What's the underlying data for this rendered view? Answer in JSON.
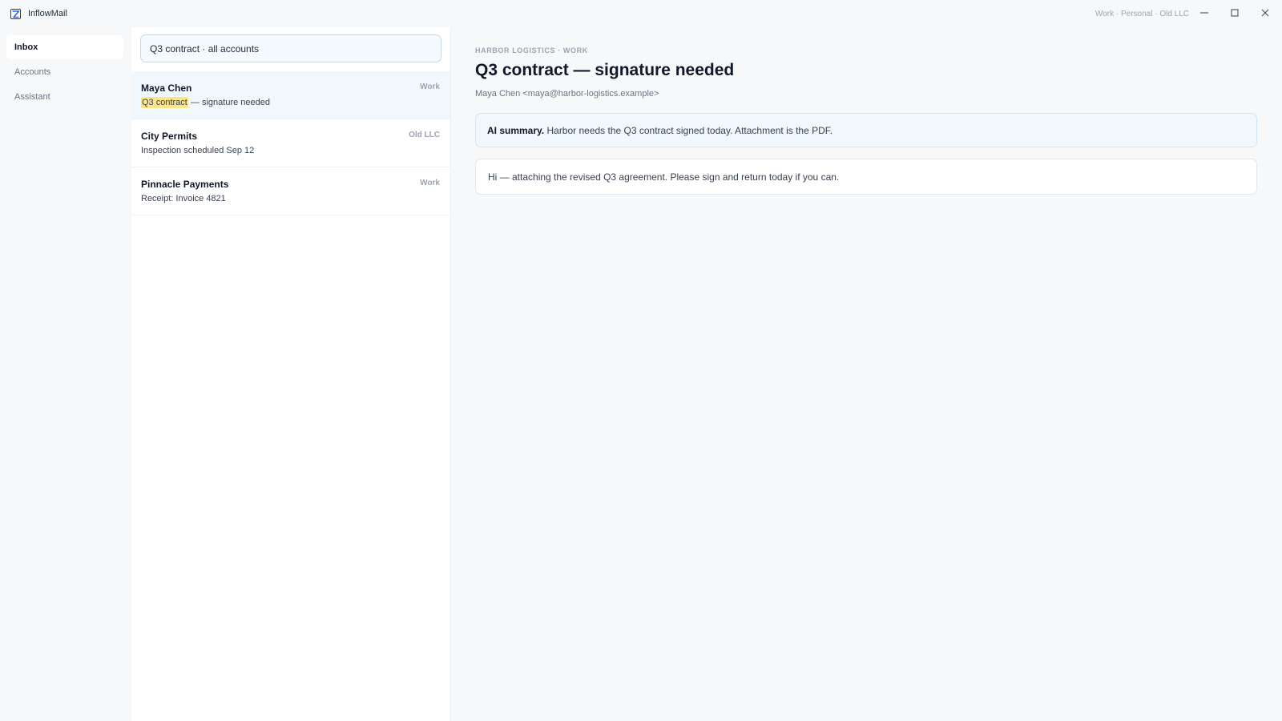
{
  "app": {
    "title": "InflowMail",
    "accounts_caption": "Work · Personal · Old LLC",
    "logo_icon": "inflowmail-logo-icon",
    "accent_color": "#2563eb"
  },
  "window_controls": {
    "minimize_icon": "minimize-icon",
    "maximize_icon": "maximize-icon",
    "close_icon": "close-icon"
  },
  "nav": {
    "items": [
      {
        "label": "Inbox",
        "active": true
      },
      {
        "label": "Accounts",
        "active": false
      },
      {
        "label": "Assistant",
        "active": false
      }
    ]
  },
  "search": {
    "value": "Q3 contract · all accounts"
  },
  "messages": [
    {
      "sender": "Maya Chen",
      "account": "Work",
      "subject_highlight": "Q3 contract",
      "subject_rest": " — signature needed",
      "selected": true
    },
    {
      "sender": "City Permits",
      "account": "Old LLC",
      "subject": "Inspection scheduled Sep 12",
      "selected": false
    },
    {
      "sender": "Pinnacle Payments",
      "account": "Work",
      "subject": "Receipt: Invoice 4821",
      "selected": false
    }
  ],
  "reading": {
    "eyebrow": "HARBOR LOGISTICS · WORK",
    "title": "Q3 contract — signature needed",
    "from": "Maya Chen <maya@harbor-logistics.example>",
    "summary_label": "AI summary.",
    "summary_text": " Harbor needs the Q3 contract signed today. Attachment is the PDF.",
    "body": "Hi — attaching the revised Q3 agreement. Please sign and return today if you can."
  },
  "colors": {
    "highlight": "#fde68a",
    "selected_row": "#f1f8fd",
    "summary_bg": "#f1f8fd"
  }
}
